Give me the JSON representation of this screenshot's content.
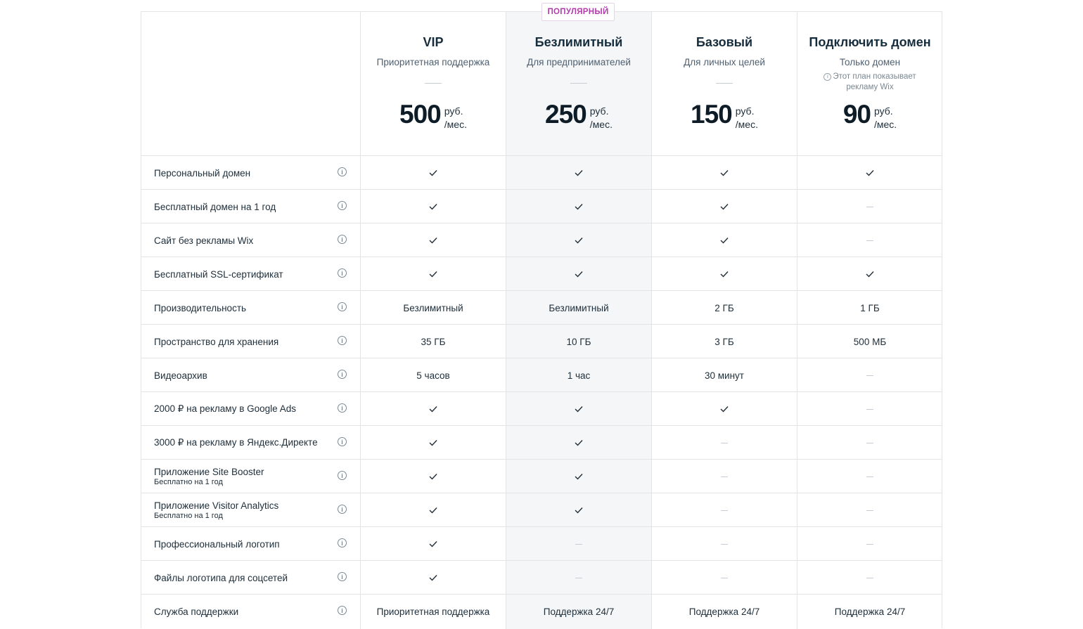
{
  "popular_badge": "ПОПУЛЯРНЫЙ",
  "plans": [
    {
      "name": "VIP",
      "subtitle": "Приоритетная поддержка",
      "note": "",
      "price": "500",
      "currency": "руб.",
      "period": "/мес."
    },
    {
      "name": "Безлимитный",
      "subtitle": "Для предпринимателей",
      "note": "",
      "price": "250",
      "currency": "руб.",
      "period": "/мес."
    },
    {
      "name": "Базовый",
      "subtitle": "Для личных целей",
      "note": "",
      "price": "150",
      "currency": "руб.",
      "period": "/мес."
    },
    {
      "name": "Подключить домен",
      "subtitle": "Только домен",
      "note": "Этот план показывает рекламу Wix",
      "price": "90",
      "currency": "руб.",
      "period": "/мес."
    }
  ],
  "features": [
    {
      "label": "Персональный домен",
      "sub": "",
      "values": [
        "check",
        "check",
        "check",
        "check"
      ]
    },
    {
      "label": "Бесплатный домен на 1 год",
      "sub": "",
      "values": [
        "check",
        "check",
        "check",
        "dash"
      ]
    },
    {
      "label": "Сайт без рекламы Wix",
      "sub": "",
      "values": [
        "check",
        "check",
        "check",
        "dash"
      ]
    },
    {
      "label": "Бесплатный SSL-сертификат",
      "sub": "",
      "values": [
        "check",
        "check",
        "check",
        "check"
      ]
    },
    {
      "label": "Производительность",
      "sub": "",
      "values": [
        "Безлимитный",
        "Безлимитный",
        "2 ГБ",
        "1 ГБ"
      ]
    },
    {
      "label": "Пространство для хранения",
      "sub": "",
      "values": [
        "35 ГБ",
        "10 ГБ",
        "3 ГБ",
        "500 МБ"
      ]
    },
    {
      "label": "Видеоархив",
      "sub": "",
      "values": [
        "5 часов",
        "1 час",
        "30 минут",
        "dash"
      ]
    },
    {
      "label": "2000 ₽ на рекламу в Google Ads",
      "sub": "",
      "values": [
        "check",
        "check",
        "check",
        "dash"
      ]
    },
    {
      "label": "3000 ₽ на рекламу в Яндекс.Директе",
      "sub": "",
      "values": [
        "check",
        "check",
        "dash",
        "dash"
      ]
    },
    {
      "label": "Приложение Site Booster",
      "sub": "Бесплатно на 1 год",
      "values": [
        "check",
        "check",
        "dash",
        "dash"
      ]
    },
    {
      "label": "Приложение Visitor Analytics",
      "sub": "Бесплатно на 1 год",
      "values": [
        "check",
        "check",
        "dash",
        "dash"
      ]
    },
    {
      "label": "Профессиональный логотип",
      "sub": "",
      "values": [
        "check",
        "dash",
        "dash",
        "dash"
      ]
    },
    {
      "label": "Файлы логотипа для соцсетей",
      "sub": "",
      "values": [
        "check",
        "dash",
        "dash",
        "dash"
      ]
    },
    {
      "label": "Служба поддержки",
      "sub": "",
      "values": [
        "Приоритетная поддержка",
        "Поддержка 24/7",
        "Поддержка 24/7",
        "Поддержка 24/7"
      ]
    }
  ],
  "icons": {
    "info": "info-icon",
    "check": "check-icon",
    "dash": "dash-icon"
  },
  "colors": {
    "popular_accent": "#b43cad",
    "popular_column_bg": "#f5f6f7",
    "border": "#e2e4e6"
  }
}
